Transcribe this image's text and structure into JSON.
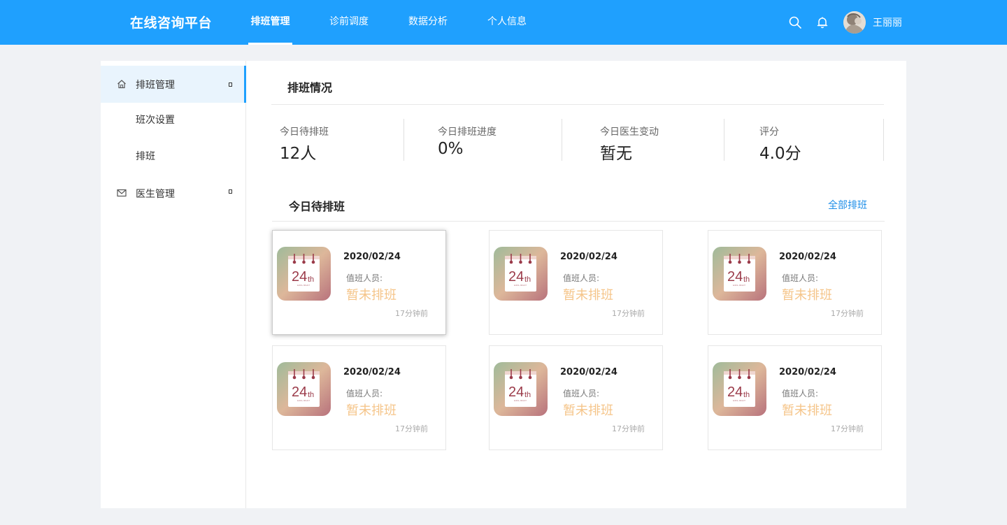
{
  "app": {
    "title": "在线咨询平台"
  },
  "nav": {
    "items": [
      {
        "label": "排班管理",
        "active": true
      },
      {
        "label": "诊前调度"
      },
      {
        "label": "数据分析"
      },
      {
        "label": "个人信息"
      }
    ],
    "search_icon": "search-icon",
    "bell_icon": "bell-icon",
    "user": "王丽丽"
  },
  "sidebar": {
    "items": [
      {
        "label": "排班管理",
        "icon": "home-icon",
        "active": true
      },
      {
        "label": "班次设置"
      },
      {
        "label": "排班"
      },
      {
        "label": "医生管理",
        "icon": "mail-icon"
      }
    ]
  },
  "overview": {
    "title": "排班情况",
    "stats": [
      {
        "label": "今日待排班",
        "value": "12人"
      },
      {
        "label": "今日排班进度",
        "value": "0%"
      },
      {
        "label": "今日医生变动",
        "value": "暂无"
      },
      {
        "label": "评分",
        "value": "4.0分"
      }
    ]
  },
  "pending": {
    "title": "今日待排班",
    "link": "全部排班",
    "cards": [
      {
        "date": "2020/02/24",
        "duty_label": "值班人员:",
        "status": "暂未排班",
        "time": "17分钟前",
        "day": "24",
        "day_suffix": "th",
        "caption": "HOLIDAY"
      },
      {
        "date": "2020/02/24",
        "duty_label": "值班人员:",
        "status": "暂未排班",
        "time": "17分钟前",
        "day": "24",
        "day_suffix": "th",
        "caption": "HOLIDAY"
      },
      {
        "date": "2020/02/24",
        "duty_label": "值班人员:",
        "status": "暂未排班",
        "time": "17分钟前",
        "day": "24",
        "day_suffix": "th",
        "caption": "HOLIDAY"
      },
      {
        "date": "2020/02/24",
        "duty_label": "值班人员:",
        "status": "暂未排班",
        "time": "17分钟前",
        "day": "24",
        "day_suffix": "th",
        "caption": "HOLIDAY"
      },
      {
        "date": "2020/02/24",
        "duty_label": "值班人员:",
        "status": "暂未排班",
        "time": "17分钟前",
        "day": "24",
        "day_suffix": "th",
        "caption": "HOLIDAY"
      },
      {
        "date": "2020/02/24",
        "duty_label": "值班人员:",
        "status": "暂未排班",
        "time": "17分钟前",
        "day": "24",
        "day_suffix": "th",
        "caption": "HOLIDAY"
      }
    ]
  },
  "colors": {
    "primary": "#1fa0fe",
    "link": "#1e8ee8",
    "status": "#f5c58a",
    "calendar_red": "#9b3b4a"
  }
}
